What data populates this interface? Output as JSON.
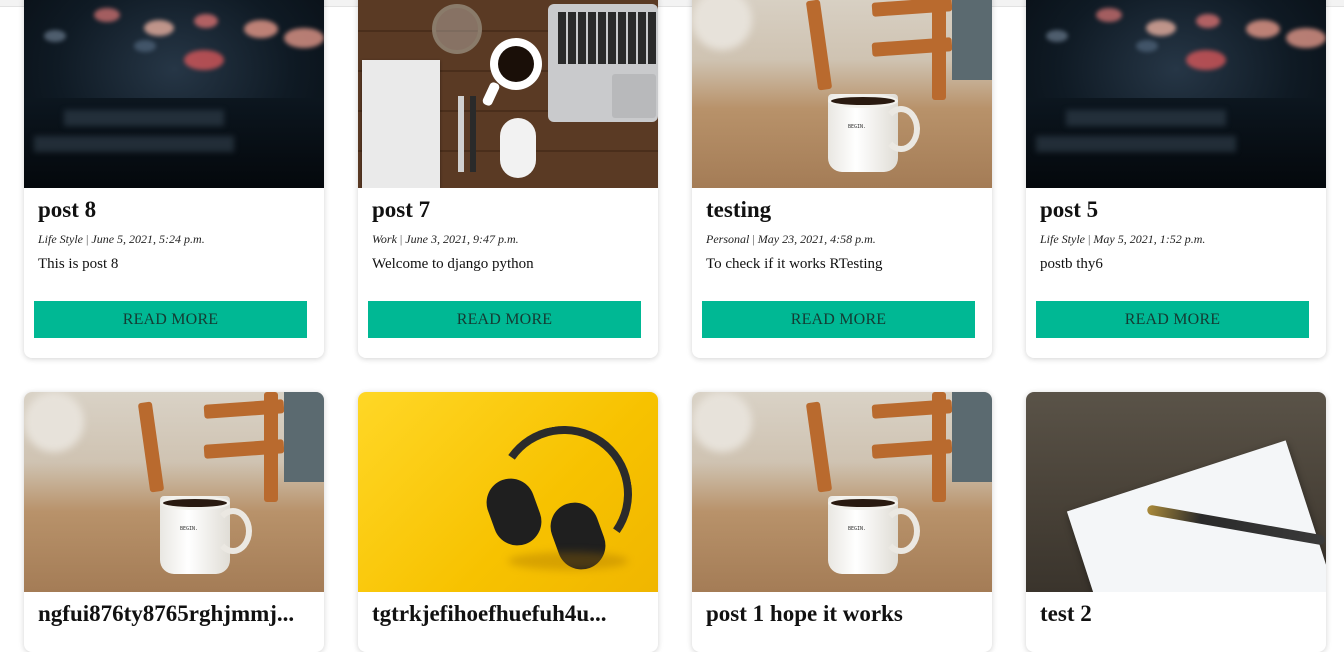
{
  "posts": [
    {
      "title": "post 8",
      "category": "Life Style",
      "date": "June 5, 2021, 5:24 p.m.",
      "excerpt": "This is post 8",
      "button": "READ MORE",
      "image": "bokeh-night-street"
    },
    {
      "title": "post 7",
      "category": "Work",
      "date": "June 3, 2021, 9:47 p.m.",
      "excerpt": "Welcome to django python",
      "button": "READ MORE",
      "image": "desk-laptop-coffee"
    },
    {
      "title": "testing",
      "category": "Personal",
      "date": "May 23, 2021, 4:58 p.m.",
      "excerpt": "To check if it works RTesting",
      "button": "READ MORE",
      "image": "coffee-mug-table"
    },
    {
      "title": "post 5",
      "category": "Life Style",
      "date": "May 5, 2021, 1:52 p.m.",
      "excerpt": "postb thy6",
      "button": "READ MORE",
      "image": "bokeh-night-street"
    },
    {
      "title": "ngfui876ty8765rghjmmj...",
      "image": "coffee-mug-table"
    },
    {
      "title": "tgtrkjefihoefhuefuh4u...",
      "image": "headphones-yellow"
    },
    {
      "title": "post 1 hope it works",
      "image": "coffee-mug-table"
    },
    {
      "title": "test 2",
      "image": "notebook-fountain-pen"
    }
  ],
  "colors": {
    "button_bg": "#00b894",
    "button_text": "#143b33"
  }
}
